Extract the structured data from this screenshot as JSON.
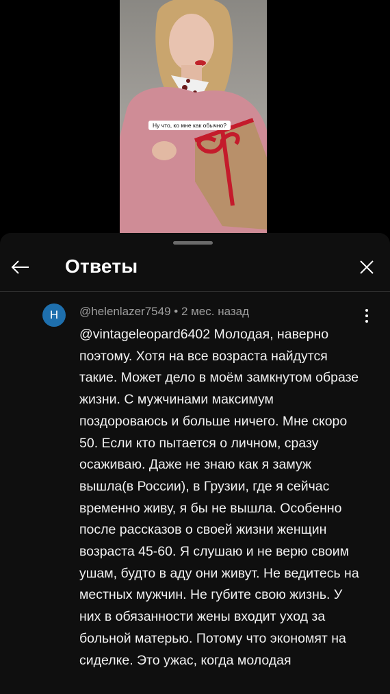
{
  "video": {
    "caption": "Ну что, ко мне как обычно?"
  },
  "header": {
    "title": "Ответы"
  },
  "comment": {
    "avatar_letter": "H",
    "author": "@helenlazer7549",
    "separator": " • ",
    "time": "2 мес. назад",
    "mention": "@vintageleopard6402",
    "text": " Молодая, наверно поэтому. Хотя на все возраста найдутся такие. Может дело в моём замкнутом образе жизни. С мужчинами максимум поздороваюсь и больше ничего. Мне скоро 50. Если кто пытается о личном, сразу осаживаю. Даже не знаю как я замуж вышла(в России), в Грузии, где я сейчас временно живу, я бы не вышла. Особенно после рассказов о своей жизни женщин возраста 45-60. Я слушаю и не верю своим ушам, будто в аду они живут. Не ведитесь на местных мужчин. Не губите свою жизнь. У них в обязанности жены входит уход за больной матерью. Потому что экономят на сиделке. Это ужас, когда молодая"
  },
  "icons": {
    "back": "arrow-left-icon",
    "close": "close-icon",
    "more": "more-vertical-icon"
  }
}
